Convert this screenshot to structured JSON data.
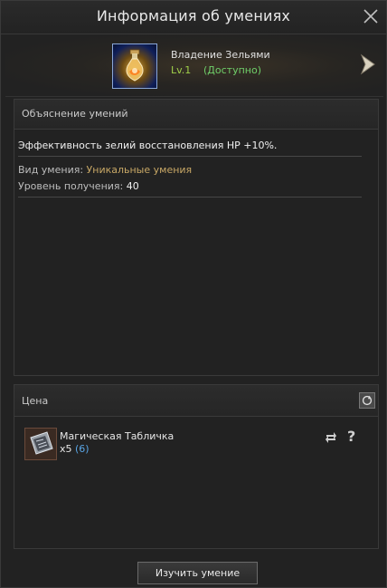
{
  "window": {
    "title": "Информация об умениях"
  },
  "skill": {
    "name": "Владение Зельями",
    "level": "Lv.1",
    "availability": "(Доступно)",
    "icon": "potion-icon"
  },
  "description": {
    "header": "Объяснение умений",
    "effect": "Эффективность зелий восстановления HP +10%.",
    "type_label": "Вид умения:",
    "type_value": "Уникальные умения",
    "level_label": "Уровень получения:",
    "level_value": "40"
  },
  "price": {
    "header": "Цена",
    "item_name": "Магическая Табличка",
    "qty_prefix": "x5",
    "qty_owned": "(6)",
    "item_icon": "magic-tablet-icon"
  },
  "footer": {
    "learn_label": "Изучить умение"
  },
  "colors": {
    "accent_green": "#9fcf4a",
    "available_green": "#6fcf6a",
    "gold_text": "#c8a866",
    "owned_blue": "#5aa6e6"
  }
}
